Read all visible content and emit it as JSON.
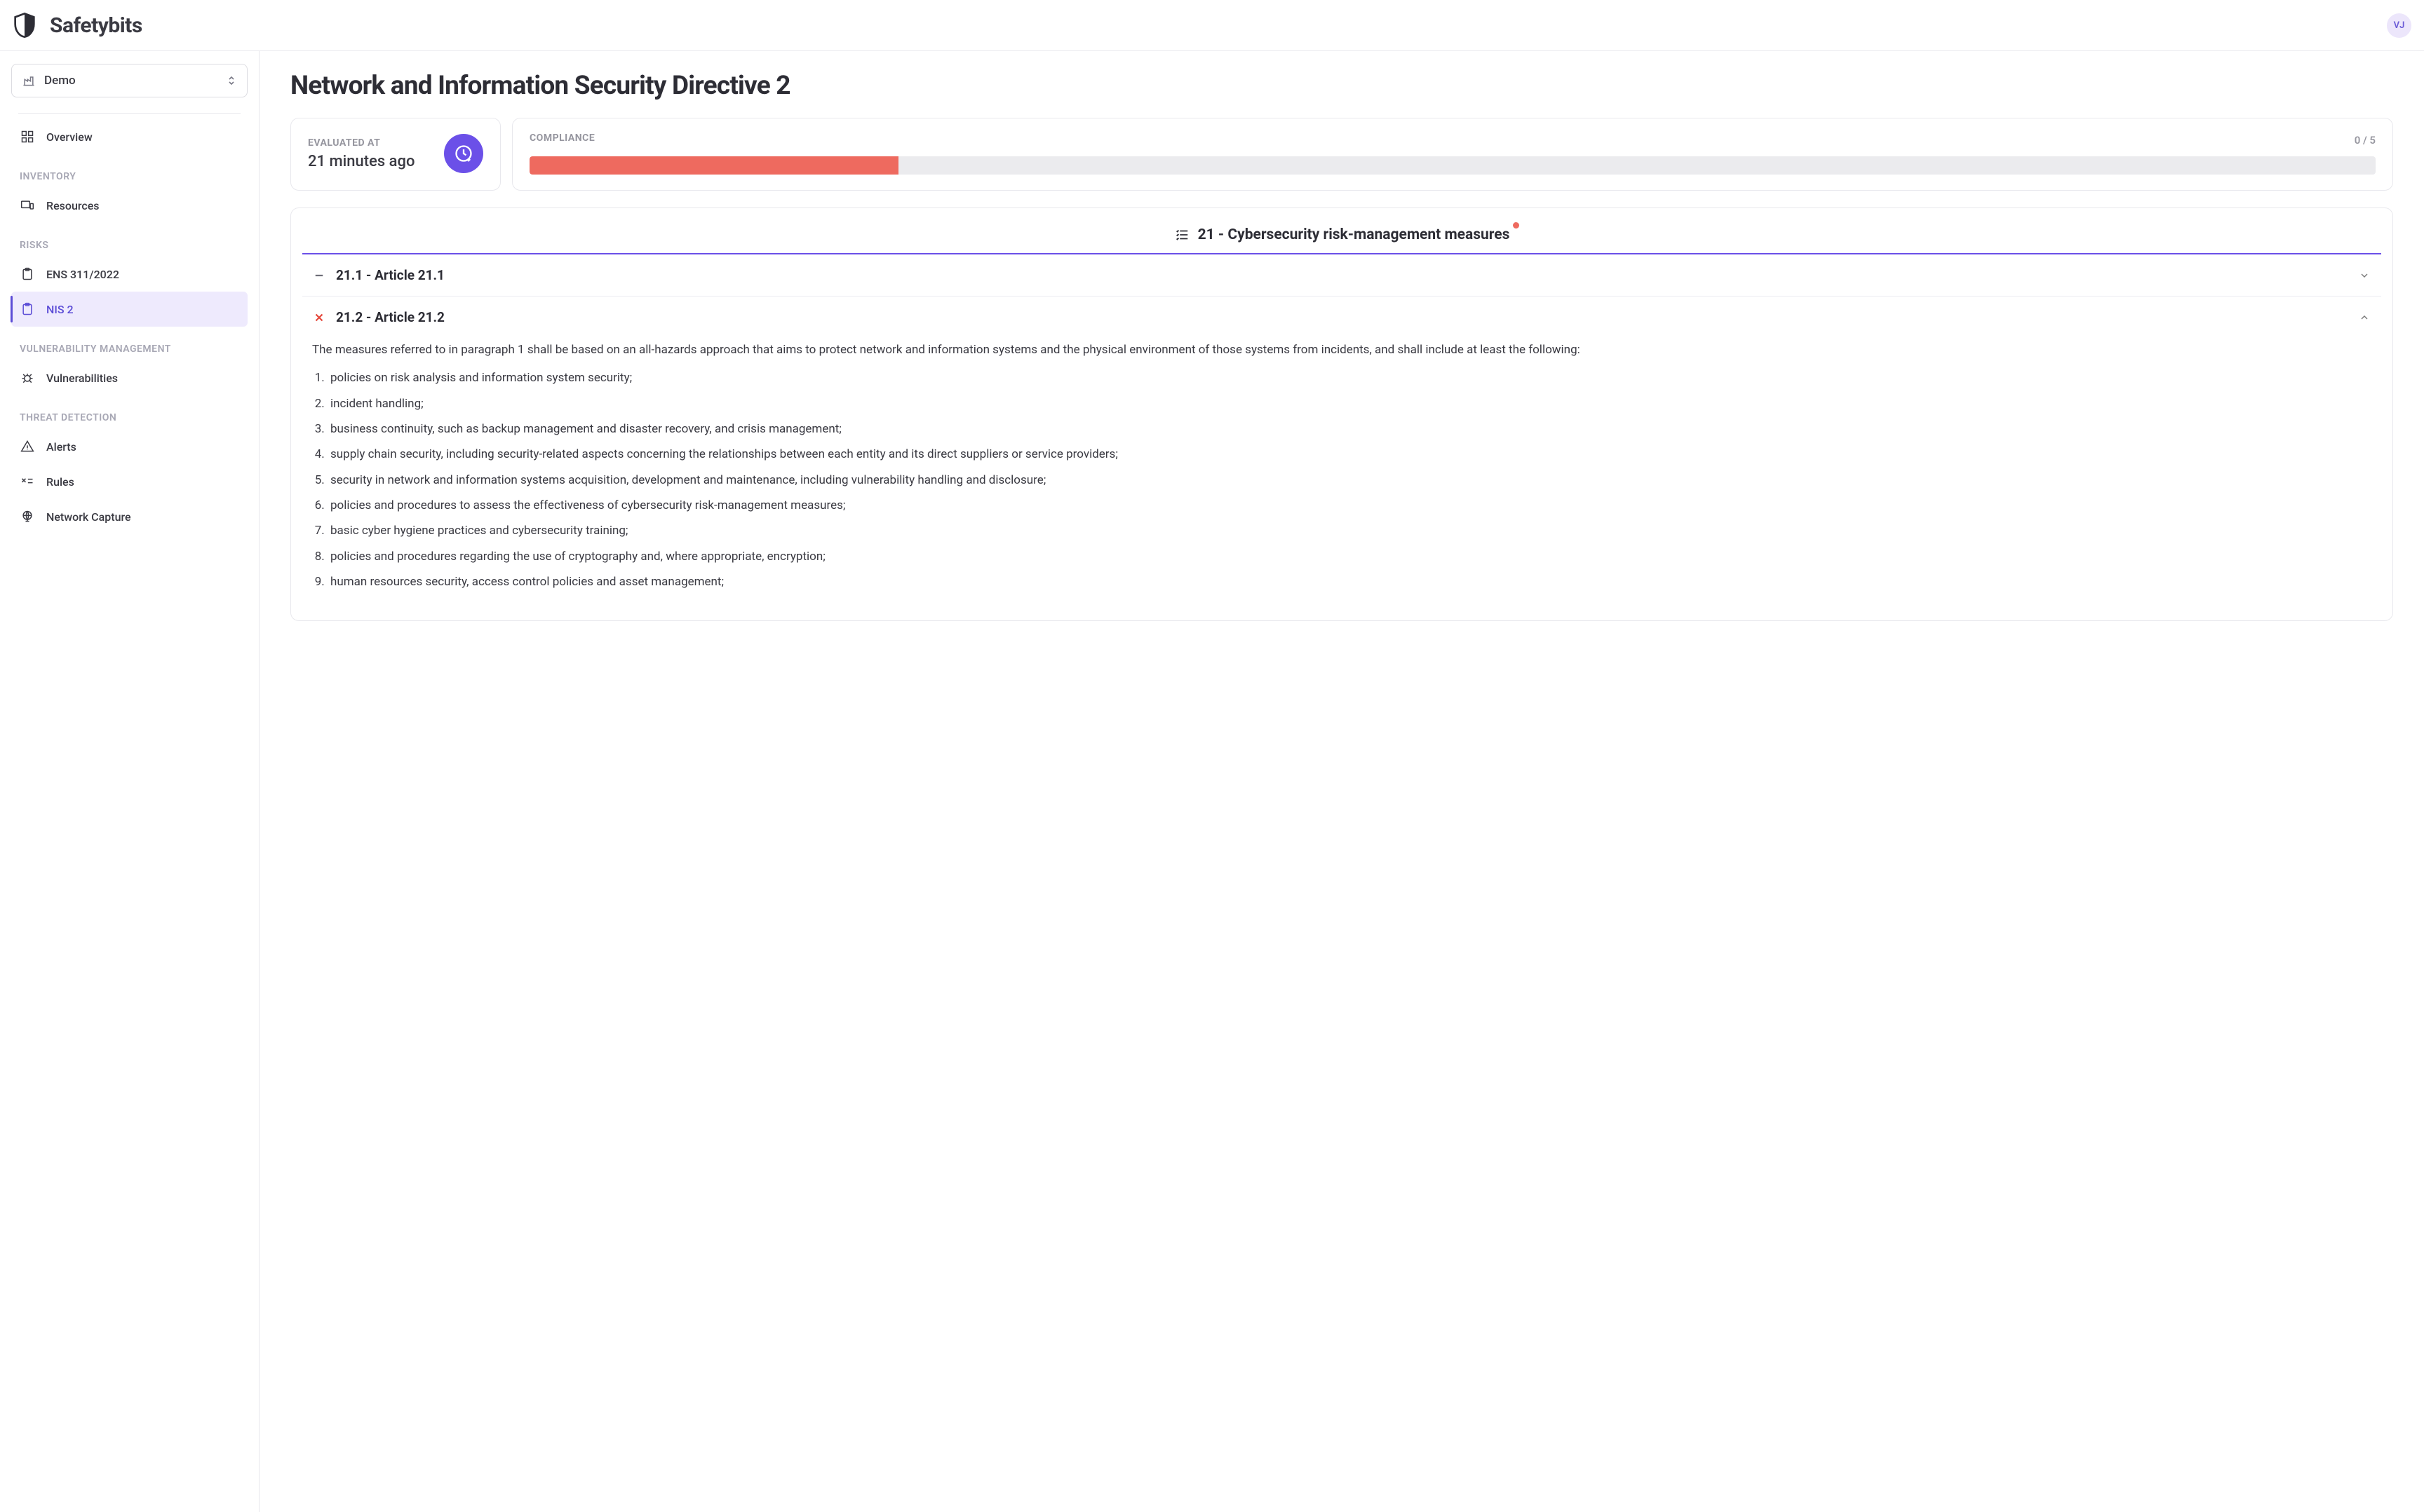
{
  "brand": "Safetybits",
  "avatar": "VJ",
  "selector": {
    "label": "Demo"
  },
  "nav": {
    "overview": "Overview",
    "headings": {
      "inventory": "INVENTORY",
      "risks": "RISKS",
      "vuln": "VULNERABILITY MANAGEMENT",
      "threat": "THREAT DETECTION"
    },
    "resources": "Resources",
    "ens": "ENS 311/2022",
    "nis2": "NIS 2",
    "vulnerabilities": "Vulnerabilities",
    "alerts": "Alerts",
    "rules": "Rules",
    "netcap": "Network Capture"
  },
  "page": {
    "title": "Network and Information Security Directive 2",
    "evaluated_label": "EVALUATED AT",
    "evaluated_value": "21 minutes ago",
    "compliance_label": "COMPLIANCE",
    "compliance_count": "0 / 5",
    "compliance_pct": 20
  },
  "section": {
    "title": "21 - Cybersecurity risk-management measures",
    "articles": {
      "a211": "21.1 - Article 21.1",
      "a212": "21.2 - Article 21.2"
    },
    "body_intro": "The measures referred to in paragraph 1 shall be based on an all-hazards approach that aims to protect network and information systems and the physical environment of those systems from incidents, and shall include at least the following:",
    "items": [
      "policies on risk analysis and information system security;",
      "incident handling;",
      "business continuity, such as backup management and disaster recovery, and crisis management;",
      "supply chain security, including security-related aspects concerning the relationships between each entity and its direct suppliers or service providers;",
      "security in network and information systems acquisition, development and maintenance, including vulnerability handling and disclosure;",
      "policies and procedures to assess the effectiveness of cybersecurity risk-management measures;",
      "basic cyber hygiene practices and cybersecurity training;",
      "policies and procedures regarding the use of cryptography and, where appropriate, encryption;",
      "human resources security, access control policies and asset management;"
    ]
  }
}
